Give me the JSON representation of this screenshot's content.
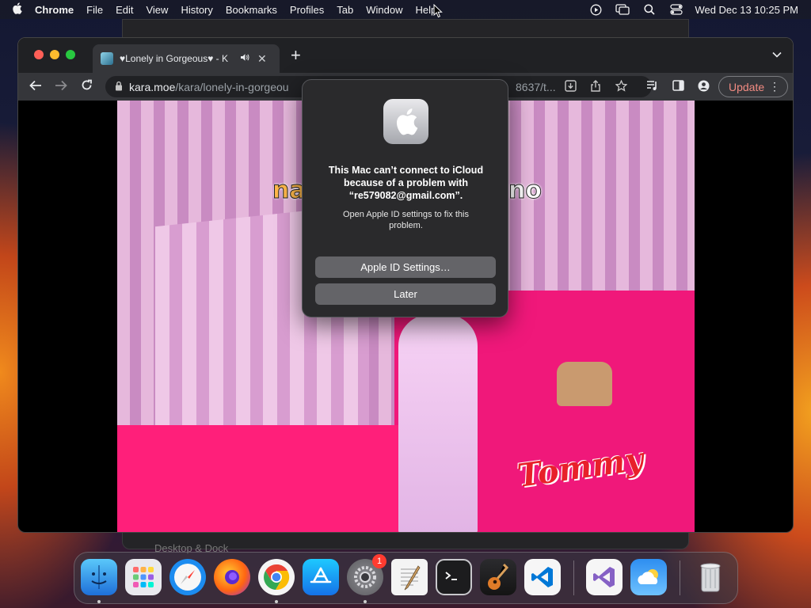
{
  "menubar": {
    "app_name": "Chrome",
    "items": [
      "File",
      "Edit",
      "View",
      "History",
      "Bookmarks",
      "Profiles",
      "Tab",
      "Window",
      "Help"
    ],
    "clock": "Wed Dec 13  10:25 PM",
    "status_icons": [
      "screen-recording-icon",
      "screen-mirroring-icon",
      "spotlight-search-icon",
      "control-center-icon"
    ]
  },
  "background_window": {
    "sidebar_item": "Desktop & Dock"
  },
  "browser": {
    "tab": {
      "title": "♥Lonely in Gorgeous♥ - K",
      "favicon": "site-favicon-icon",
      "audio": "speaker-icon"
    },
    "url": {
      "host": "kara.moe",
      "path": "/kara/lonely-in-gorgeou",
      "tail": "8637/t..."
    },
    "update_label": "Update"
  },
  "video": {
    "caption_left": "na",
    "caption_right": "no",
    "logo_text": "Tommy"
  },
  "alert": {
    "title": "This Mac can’t connect to iCloud because of a problem with “re579082@gmail.com”.",
    "body": "Open Apple ID settings to fix this problem.",
    "primary_button": "Apple ID Settings…",
    "secondary_button": "Later"
  },
  "dock": {
    "items": [
      {
        "name": "finder-icon",
        "running": true
      },
      {
        "name": "launchpad-icon",
        "running": false
      },
      {
        "name": "safari-icon",
        "running": false
      },
      {
        "name": "firefox-icon",
        "running": false
      },
      {
        "name": "chrome-icon",
        "running": true
      },
      {
        "name": "app-store-icon",
        "running": false
      },
      {
        "name": "system-settings-icon",
        "running": true,
        "badge": "1"
      },
      {
        "name": "textedit-icon",
        "running": false
      },
      {
        "name": "terminal-icon",
        "running": false
      },
      {
        "name": "garageband-icon",
        "running": false
      },
      {
        "name": "vscode-icon",
        "running": false
      },
      {
        "name": "visual-studio-icon",
        "running": false
      },
      {
        "name": "weather-icon",
        "running": false
      },
      {
        "name": "trash-icon",
        "running": false
      }
    ]
  },
  "colors": {
    "update_text": "#f28b82",
    "badge": "#ff3b30",
    "traffic_close": "#ff5f57",
    "traffic_minimize": "#febc2e",
    "traffic_zoom": "#28c840"
  }
}
